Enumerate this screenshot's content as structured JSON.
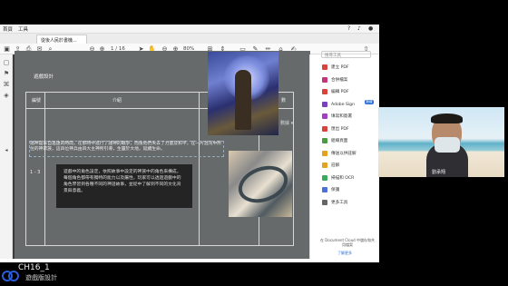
{
  "menubar": {
    "items": [
      "首頁",
      "工具"
    ]
  },
  "tab": {
    "title": "從後人民於書機..."
  },
  "toolbar": {
    "page_display": "1 / 16",
    "zoom": "80%"
  },
  "page": {
    "title": "遊戲設計",
    "table": {
      "headers": [
        "編號",
        "介紹",
        "",
        "數"
      ],
      "row_number": "1 - 3",
      "selected_text": "諸神是來自遙遠的時間，在那時中進行了諸神的戰爭，而後他們失去了力量及和平，在一片混沌中所住的神眾族，這四位神兵由四大主神所引導，生靈於大地，延續生命。",
      "textbox_text": "遊戲中的角色設定，依照故事中設定的神族中的角色來構成，每個角色都帶有獨特的能力以及屬性，玩家可以透過遊戲中的角色學習到各種不同的神話故事，並從中了解到不同的文化背景與意義。"
    },
    "side_button": "數據 ▾"
  },
  "tools": {
    "search_placeholder": "搜尋工具",
    "items": [
      {
        "label": "建立 PDF",
        "color": "#d9433b"
      },
      {
        "label": "合併檔案",
        "color": "#c2357a"
      },
      {
        "label": "編輯 PDF",
        "color": "#d9433b"
      },
      {
        "label": "Adobe Sign",
        "color": "#7b3fc4"
      },
      {
        "label": "填寫和簽署",
        "color": "#a23fc4"
      },
      {
        "label": "匯出 PDF",
        "color": "#d9433b"
      },
      {
        "label": "組織頁面",
        "color": "#4b9b45"
      },
      {
        "label": "傳送以供註解",
        "color": "#e3a321"
      },
      {
        "label": "註解",
        "color": "#e3a321"
      },
      {
        "label": "掃描和 OCR",
        "color": "#3bab5b"
      },
      {
        "label": "保護",
        "color": "#4d6fd6"
      },
      {
        "label": "更多工具",
        "color": "#666666"
      }
    ],
    "new_badge": "新增",
    "promo": "在 Document Cloud 中儲存和共用檔案",
    "promo_link": "了解更多"
  },
  "webcam": {
    "name": "劉承翔"
  },
  "footer": {
    "course": "CH16_1",
    "subtitle": "遊戲版設計"
  }
}
